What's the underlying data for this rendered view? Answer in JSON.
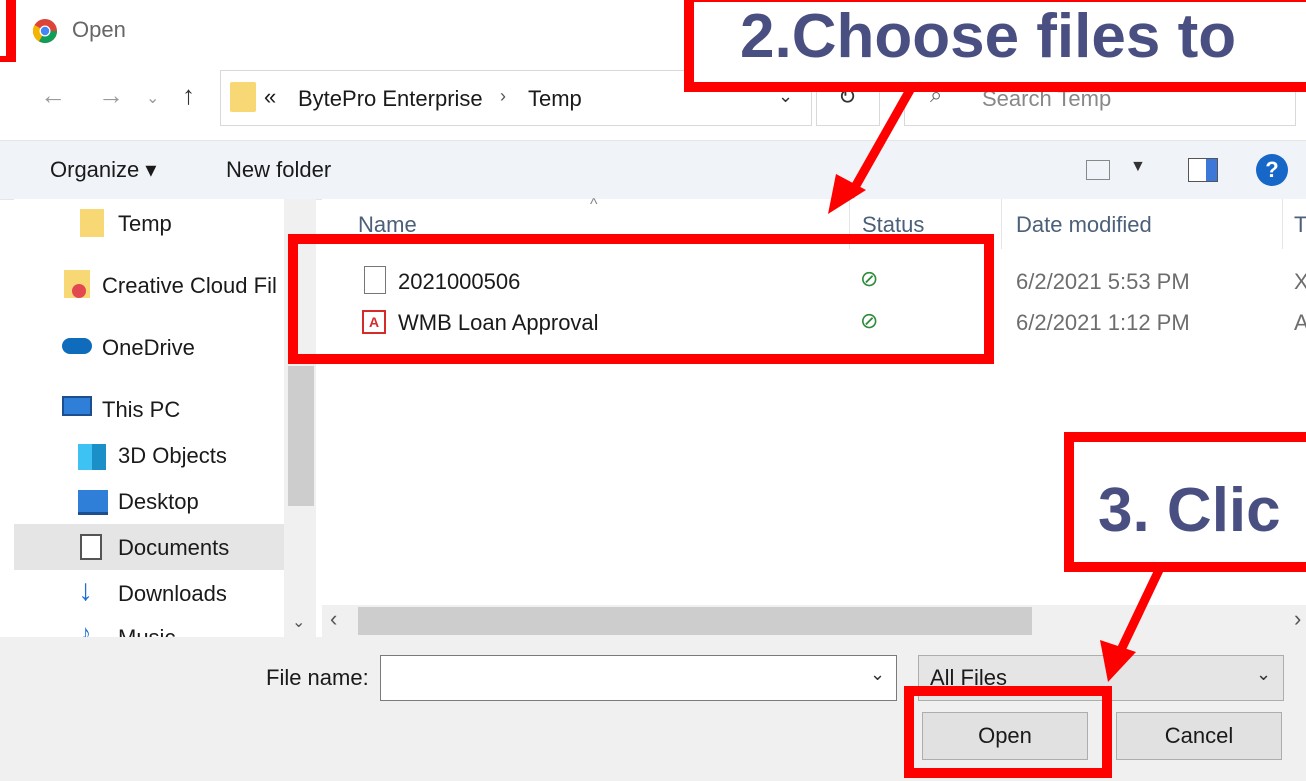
{
  "window": {
    "title": "Open"
  },
  "nav": {
    "breadcrumb_prefix": "«",
    "breadcrumb": [
      "BytePro Enterprise",
      "Temp"
    ],
    "search_placeholder": "Search Temp"
  },
  "toolbar": {
    "organize": "Organize ▾",
    "new_folder": "New folder"
  },
  "sidebar": {
    "items": [
      {
        "label": "Temp",
        "icon": "folder-icon"
      },
      {
        "label": "Creative Cloud Fil",
        "icon": "creative-cloud-icon"
      },
      {
        "label": "OneDrive",
        "icon": "cloud-icon"
      },
      {
        "label": "This PC",
        "icon": "monitor-icon"
      },
      {
        "label": "3D Objects",
        "icon": "cube-icon"
      },
      {
        "label": "Desktop",
        "icon": "desktop-icon"
      },
      {
        "label": "Documents",
        "icon": "documents-icon",
        "selected": true
      },
      {
        "label": "Downloads",
        "icon": "download-arrow-icon"
      },
      {
        "label": "Music",
        "icon": "music-icon"
      }
    ]
  },
  "file_list": {
    "columns": [
      "Name",
      "Status",
      "Date modified",
      "Ty"
    ],
    "rows": [
      {
        "name": "2021000506",
        "icon": "blank-file-icon",
        "status": "synced",
        "date": "6/2/2021 5:53 PM",
        "type": "X"
      },
      {
        "name": "WMB Loan Approval",
        "icon": "pdf-icon",
        "status": "synced",
        "date": "6/2/2021 1:12 PM",
        "type": "A"
      }
    ]
  },
  "bottom": {
    "filename_label": "File name:",
    "filename_value": "",
    "filetype": "All Files",
    "open_button": "Open",
    "cancel_button": "Cancel"
  },
  "annotations": {
    "step2": "2.Choose files to",
    "step3": "3. Clic"
  },
  "colors": {
    "highlight": "#ff0000",
    "callout_text": "#4a4f82",
    "status_green": "#2e8b3a"
  }
}
